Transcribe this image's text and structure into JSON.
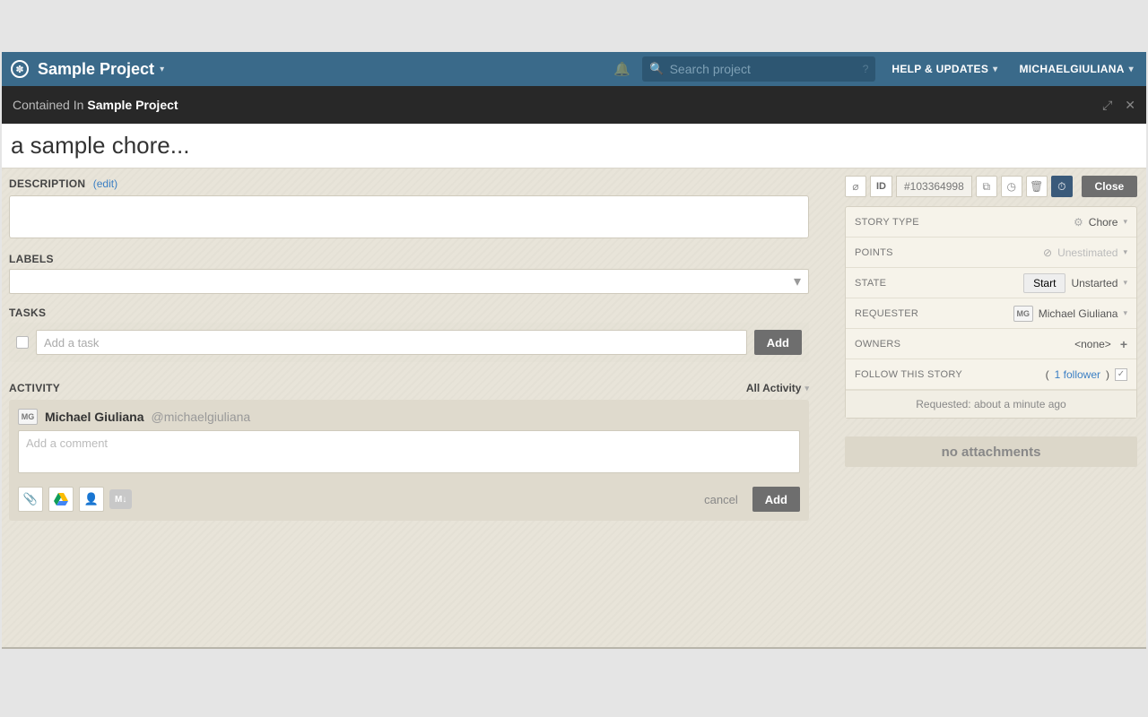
{
  "header": {
    "project_name": "Sample Project",
    "search_placeholder": "Search project",
    "help_label": "HELP & UPDATES",
    "username": "MICHAELGIULIANA"
  },
  "subheader": {
    "contained_label": "Contained In",
    "project": "Sample Project"
  },
  "story": {
    "title": "a sample chore...",
    "description_label": "DESCRIPTION",
    "edit_label": "(edit)",
    "labels_label": "LABELS",
    "tasks_label": "TASKS",
    "task_placeholder": "Add a task",
    "task_add_label": "Add",
    "activity_label": "ACTIVITY",
    "activity_filter": "All Activity"
  },
  "comment": {
    "author_initials": "MG",
    "author_name": "Michael Giuliana",
    "author_handle": "@michaelgiuliana",
    "placeholder": "Add a comment",
    "markdown_chip": "M↓",
    "cancel_label": "cancel",
    "add_label": "Add"
  },
  "sidebar": {
    "id_label": "ID",
    "id_value": "#103364998",
    "close_label": "Close",
    "story_type_label": "STORY TYPE",
    "story_type_value": "Chore",
    "points_label": "POINTS",
    "points_value": "Unestimated",
    "state_label": "STATE",
    "start_label": "Start",
    "state_value": "Unstarted",
    "requester_label": "REQUESTER",
    "requester_initials": "MG",
    "requester_name": "Michael Giuliana",
    "owners_label": "OWNERS",
    "owners_value": "<none>",
    "follow_label": "FOLLOW THIS STORY",
    "follower_count_prefix": "(",
    "follower_link": "1 follower",
    "follower_count_suffix": ")",
    "requested_text": "Requested: about a minute ago",
    "no_attachments": "no attachments"
  }
}
